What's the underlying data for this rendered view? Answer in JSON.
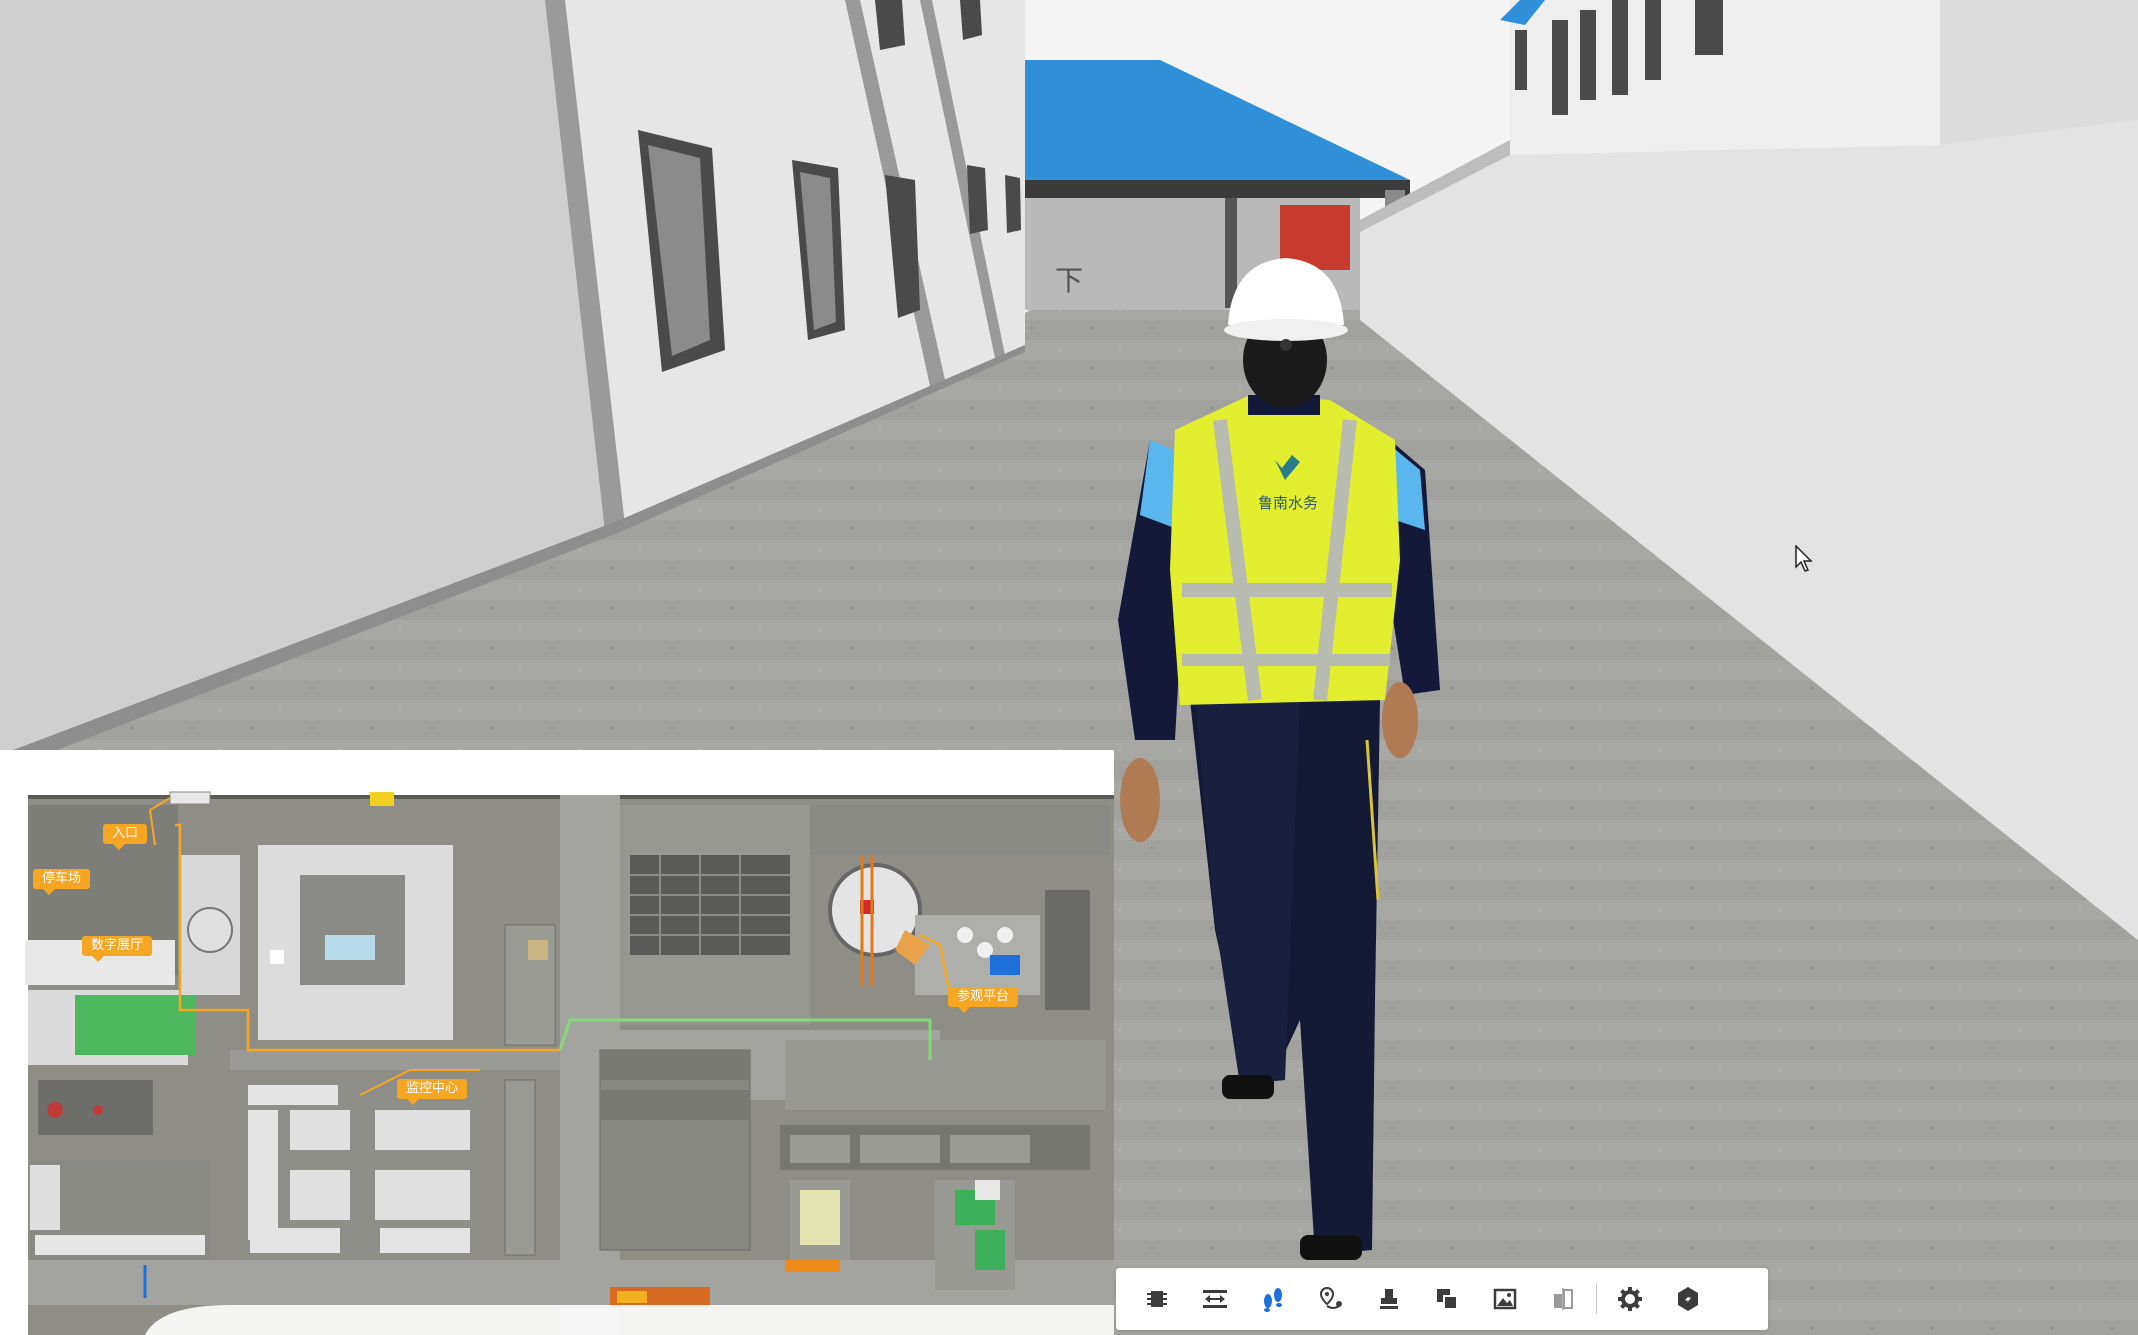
{
  "scene": {
    "vest_logo_text": "鲁南水务",
    "wall_sign": "下"
  },
  "minimap": {
    "labels": {
      "entrance": "入口",
      "parking": "停车场",
      "digital_hall": "数字展厅",
      "monitoring_center": "监控中心",
      "visit_platform": "参观平台"
    }
  },
  "toolbar": {
    "buttons": [
      {
        "name": "chip-icon",
        "active": false
      },
      {
        "name": "measure-icon",
        "active": false
      },
      {
        "name": "footprints-icon",
        "active": true
      },
      {
        "name": "route-pin-icon",
        "active": false
      },
      {
        "name": "stamp-icon",
        "active": false
      },
      {
        "name": "layers-icon",
        "active": false
      },
      {
        "name": "image-icon",
        "active": false
      },
      {
        "name": "split-view-icon",
        "active": false
      },
      {
        "name": "gear-icon",
        "active": false
      },
      {
        "name": "compass-icon",
        "active": false
      }
    ]
  },
  "colors": {
    "accent": "#1e6fd9",
    "icon": "#3c3c3c",
    "label_bg": "#f5a623",
    "roof_blue": "#2f8fd8",
    "vest_yellow": "#e2ef2e"
  }
}
